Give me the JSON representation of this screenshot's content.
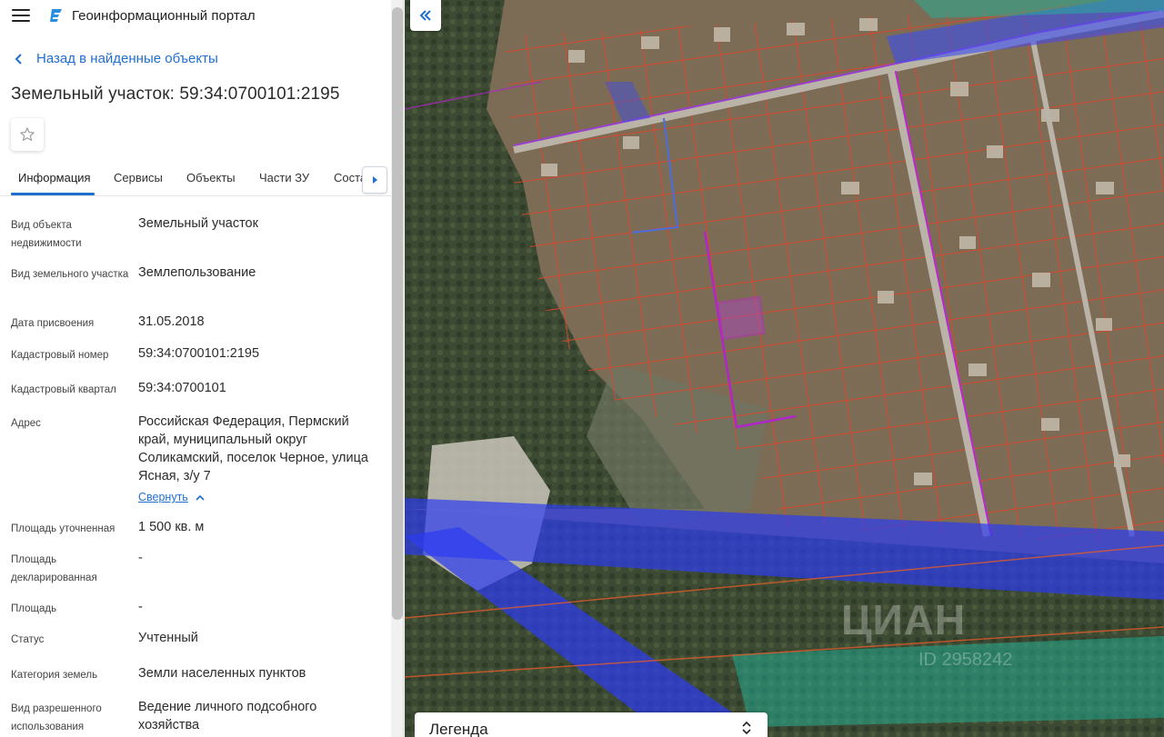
{
  "header": {
    "app_title": "Геоинформационный портал"
  },
  "nav": {
    "back_label": "Назад в найденные объекты"
  },
  "page": {
    "title": "Земельный участок: 59:34:0700101:2195"
  },
  "tabs": [
    {
      "label": "Информация",
      "active": true
    },
    {
      "label": "Сервисы",
      "active": false
    },
    {
      "label": "Объекты",
      "active": false
    },
    {
      "label": "Части ЗУ",
      "active": false
    },
    {
      "label": "Состав",
      "active": false
    }
  ],
  "fields": [
    {
      "label": "Вид объекта недвижимости",
      "value": "Земельный участок"
    },
    {
      "label": "Вид земельного участка",
      "value": "Землепользование"
    },
    {
      "label": "Дата присвоения",
      "value": "31.05.2018"
    },
    {
      "label": "Кадастровый номер",
      "value": "59:34:0700101:2195"
    },
    {
      "label": "Кадастровый квартал",
      "value": "59:34:0700101"
    },
    {
      "label": "Адрес",
      "value": "Российская Федерация, Пермский край, муниципальный округ Соликамский, поселок Черное, улица Ясная, з/у 7",
      "collapse_label": "Свернуть"
    },
    {
      "label": "Площадь уточненная",
      "value": "1 500 кв. м"
    },
    {
      "label": "Площадь декларированная",
      "value": "-"
    },
    {
      "label": "Площадь",
      "value": "-"
    },
    {
      "label": "Статус",
      "value": "Учтенный"
    },
    {
      "label": "Категория земель",
      "value": "Земли населенных пунктов"
    },
    {
      "label": "Вид разрешенного использования",
      "value": "Ведение личного подсобного хозяйства"
    }
  ],
  "map": {
    "legend_title": "Легенда",
    "watermark": "ЦИАН",
    "watermark_id": "ID 2958242"
  },
  "colors": {
    "accent": "#1f6fd1",
    "parcel_outline": "#e0442a",
    "selected_parcel": "#c026d3",
    "zone_blue": "#2c3cf0",
    "zone_teal": "#1fb39a"
  }
}
